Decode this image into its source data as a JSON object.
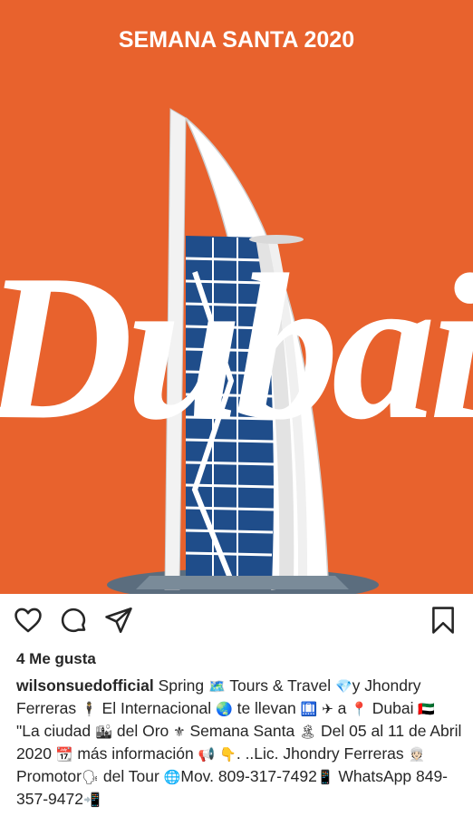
{
  "post": {
    "image": {
      "headline": "SEMANA SANTA 2020",
      "script_word": "Dubai",
      "background_color": "#e8622d"
    }
  },
  "actions": {
    "like_icon": "heart-icon",
    "comment_icon": "comment-icon",
    "share_icon": "share-icon",
    "save_icon": "bookmark-icon"
  },
  "likes_text": "4 Me gusta",
  "caption": {
    "username": "wilsonsuedofficial",
    "segments": [
      " Spring ",
      "🗺️",
      " Tours & Travel ",
      "💎",
      "y Jhondry Ferreras ",
      "🕴",
      " El Internacional ",
      "🌏",
      " te llevan ",
      "🛄",
      " ",
      "✈",
      " a ",
      "📍",
      " Dubai ",
      "🇦🇪",
      " \"La ciudad ",
      "🏙",
      " del Oro ",
      "⚜",
      " Semana Santa ",
      "🏝",
      " Del 05 al 11 de Abril 2020 ",
      "📆",
      " más información ",
      "📢",
      " ",
      "👇",
      ". ..Lic. Jhondry Ferreras ",
      "👳🏻",
      " Promotor",
      "🗣",
      " del Tour ",
      "🌐",
      "Mov. 809-317-7492",
      "📱",
      " WhatsApp 849-357-9472",
      "📲"
    ]
  }
}
